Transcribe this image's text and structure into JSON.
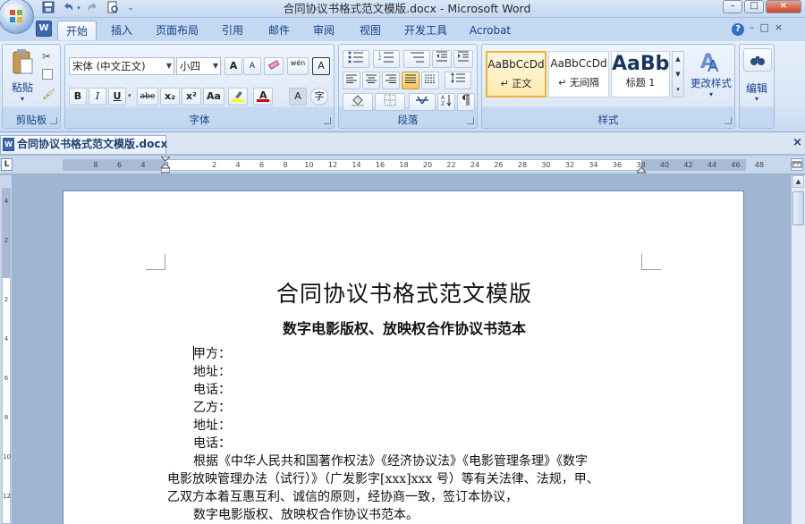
{
  "window": {
    "title": "合同协议书格式范文模版.docx - Microsoft Word",
    "controls": [
      "–",
      "□",
      "×"
    ]
  },
  "office_button": {
    "icon": "office-logo-icon"
  },
  "quick_access": [
    "save-icon",
    "undo-icon",
    "redo-icon",
    "print-preview-icon",
    "customize-dropdown-icon"
  ],
  "tabs": [
    "开始",
    "插入",
    "页面布局",
    "引用",
    "邮件",
    "审阅",
    "视图",
    "开发工具",
    "Acrobat"
  ],
  "active_tab": "开始",
  "ribbon": {
    "clipboard": {
      "label": "剪贴板",
      "paste": "粘贴"
    },
    "font": {
      "label": "字体",
      "font_name": "宋体 (中文正文)",
      "font_size": "小四",
      "bold": "B",
      "italic": "I",
      "underline": "U",
      "strike": "abe",
      "subscript": "x₂",
      "superscript": "x²",
      "change_case": "Aa",
      "grow": "A",
      "shrink": "A",
      "phonetic": "wén",
      "border_char": "A",
      "shading_char": "A",
      "enclose": "字"
    },
    "paragraph": {
      "label": "段落"
    },
    "styles": {
      "label": "样式",
      "items": [
        {
          "sample": "AaBbCcDd",
          "name": "↵ 正文"
        },
        {
          "sample": "AaBbCcDd",
          "name": "↵ 无间隔"
        },
        {
          "sample": "AaBb",
          "name": "标题 1"
        }
      ],
      "change_styles": "更改样式"
    },
    "editing": {
      "label": "编辑"
    }
  },
  "document_tab": {
    "name": "合同协议书格式范文模版.docx"
  },
  "ruler": {
    "ticks": [
      "8",
      "6",
      "4",
      "2",
      "",
      "2",
      "4",
      "6",
      "8",
      "10",
      "12",
      "14",
      "16",
      "18",
      "20",
      "22",
      "24",
      "26",
      "28",
      "30",
      "32",
      "34",
      "36",
      "38",
      "40",
      "42",
      "44",
      "46",
      "48"
    ],
    "vticks": [
      "4",
      "",
      "2",
      "",
      "",
      "2",
      "",
      "4",
      "",
      "6",
      "",
      "8",
      "",
      "10",
      "",
      "12"
    ]
  },
  "document": {
    "title": "合同协议书格式范文模版",
    "subtitle": "数字电影版权、放映权合作协议书范本",
    "lines": [
      "甲方：",
      "地址：",
      "电话：",
      "乙方：",
      "地址：",
      "电话：",
      "根据《中华人民共和国著作权法》《经济协议法》《电影管理条理》《数字",
      "电影放映管理办法（试行）》（广发影字[xxx]xxx 号）等有关法律、法规，甲、",
      "乙双方本着互惠互利、诚信的原则，经协商一致，签订本协议，",
      "数字电影版权、放映权合作协议书范本。"
    ]
  }
}
